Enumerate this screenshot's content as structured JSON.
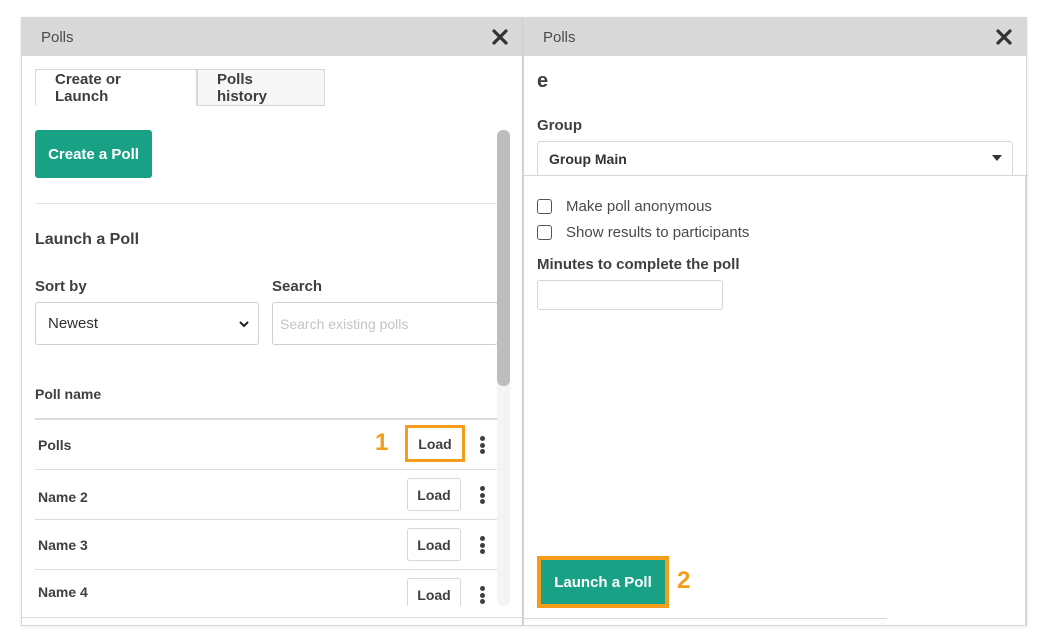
{
  "left_panel": {
    "title": "Polls",
    "close_icon": "close-icon",
    "tabs": [
      {
        "label": "Create or Launch",
        "active": true
      },
      {
        "label": "Polls history",
        "active": false
      }
    ],
    "create_poll_label": "Create a Poll",
    "launch_heading": "Launch a Poll",
    "sort_by_label": "Sort by",
    "sort_by_value": "Newest",
    "search_label": "Search",
    "search_placeholder": "Search existing polls",
    "search_value": "",
    "column_header": "Poll name",
    "polls": [
      {
        "name": "Polls",
        "load_label": "Load",
        "highlighted": true,
        "step": "1"
      },
      {
        "name": "Name 2",
        "load_label": "Load",
        "highlighted": false
      },
      {
        "name": "Name 3",
        "load_label": "Load",
        "highlighted": false
      },
      {
        "name": "Name 4",
        "load_label": "Load",
        "highlighted": false
      }
    ]
  },
  "right_panel": {
    "title": "Polls",
    "close_icon": "close-icon",
    "poll_title": "e",
    "group_label": "Group",
    "group_value": "Group Main",
    "options": [
      {
        "label": "Make poll anonymous",
        "checked": false
      },
      {
        "label": "Show results to participants",
        "checked": false
      }
    ],
    "minutes_label": "Minutes to complete the poll",
    "minutes_value": "",
    "launch_label": "Launch a Poll",
    "launch_step": "2"
  },
  "colors": {
    "accent_green": "#19a186",
    "highlight_orange": "#f59c1a",
    "header_gray": "#d9d9d9"
  }
}
